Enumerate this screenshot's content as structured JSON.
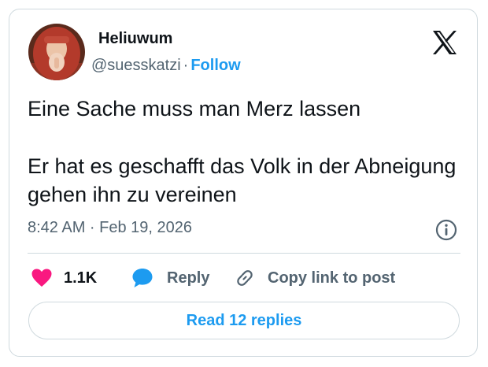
{
  "author": {
    "display_name": "Heliuwum",
    "handle": "@suesskatzi",
    "separator": "·",
    "follow_label": "Follow"
  },
  "post": {
    "text_line_1": "Eine Sache muss man Merz lassen",
    "text_line_2": "Er hat es geschafft das Volk in der Abneigung gehen ihn zu vereinen",
    "timestamp": "8:42 AM · Feb 19, 2026"
  },
  "actions": {
    "like_count": "1.1K",
    "reply_label": "Reply",
    "copy_link_label": "Copy link to post"
  },
  "read_replies_label": "Read 12 replies",
  "icons": {
    "logo": "x-logo-icon",
    "info": "info-icon",
    "like": "heart-icon",
    "reply": "speech-bubble-icon",
    "copy": "link-icon"
  },
  "colors": {
    "accent": "#1d9bf0",
    "like": "#f91880",
    "text": "#0f1419",
    "secondary": "#536471",
    "border": "#cfd9de"
  }
}
